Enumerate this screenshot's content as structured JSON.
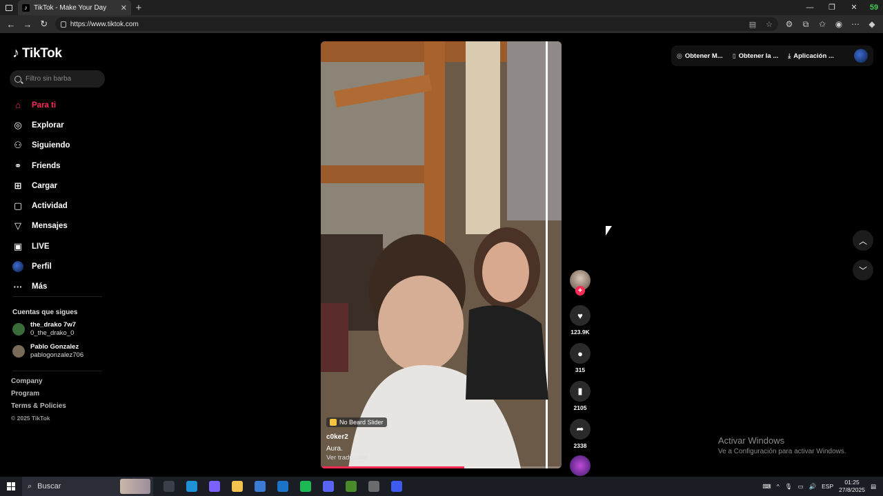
{
  "browser": {
    "tab_title": "TikTok - Make Your Day",
    "url": "https://www.tiktok.com"
  },
  "brand": {
    "name": "TikTok"
  },
  "search": {
    "placeholder": "Filtro sin barba"
  },
  "nav": [
    {
      "key": "for-you",
      "label": "Para ti",
      "icon": "home-icon",
      "active": true
    },
    {
      "key": "explore",
      "label": "Explorar",
      "icon": "compass-icon"
    },
    {
      "key": "following",
      "label": "Siguiendo",
      "icon": "user-follow-icon"
    },
    {
      "key": "friends",
      "label": "Friends",
      "icon": "friends-icon"
    },
    {
      "key": "upload",
      "label": "Cargar",
      "icon": "upload-icon"
    },
    {
      "key": "activity",
      "label": "Actividad",
      "icon": "activity-icon"
    },
    {
      "key": "messages",
      "label": "Mensajes",
      "icon": "messages-icon"
    },
    {
      "key": "live",
      "label": "LIVE",
      "icon": "live-icon"
    },
    {
      "key": "profile",
      "label": "Perfil",
      "icon": "profile-avatar"
    },
    {
      "key": "more",
      "label": "Más",
      "icon": "more-icon"
    }
  ],
  "following": {
    "title": "Cuentas que sigues",
    "accounts": [
      {
        "name": "the_drako 7w7",
        "handle": "0_the_drako_0",
        "color": "#3a6b3a"
      },
      {
        "name": "Pablo Gonzalez",
        "handle": "pablogonzalez706",
        "color": "#7a6a5a"
      }
    ]
  },
  "footer": {
    "links": [
      "Company",
      "Program",
      "Terms & Policies"
    ],
    "copyright": "© 2025 TikTok"
  },
  "video": {
    "effect": "No Beard Slider",
    "username": "c0ker2",
    "caption": "Aura.",
    "translate": "Ver traducción",
    "progress": 0.597
  },
  "actions": {
    "likes": "123.9K",
    "comments": "315",
    "saves": "2105",
    "shares": "2338"
  },
  "topbar": {
    "coins": "Obtener M...",
    "app": "Obtener la ...",
    "desktop": "Aplicación ..."
  },
  "watermark": {
    "line1": "Activar Windows",
    "line2": "Ve a Configuración para activar Windows."
  },
  "taskbar": {
    "search": "Buscar",
    "lang": "ESP",
    "time": "01:25",
    "date": "27/8/2025",
    "apps": [
      {
        "name": "task-view",
        "color": "#3b3f49"
      },
      {
        "name": "edge",
        "color": "#1f8fd6"
      },
      {
        "name": "copilot",
        "color": "#7b61ff"
      },
      {
        "name": "explorer",
        "color": "#f2c14e"
      },
      {
        "name": "store",
        "color": "#3a7bd5"
      },
      {
        "name": "mail",
        "color": "#1c74c9"
      },
      {
        "name": "spotify",
        "color": "#1db954"
      },
      {
        "name": "discord",
        "color": "#5865f2"
      },
      {
        "name": "minecraft",
        "color": "#4a8a2a"
      },
      {
        "name": "obs",
        "color": "#6b6b6b"
      },
      {
        "name": "app",
        "color": "#3d5af1"
      }
    ]
  },
  "colors": {
    "accent": "#fe2c55",
    "background": "#000000"
  }
}
